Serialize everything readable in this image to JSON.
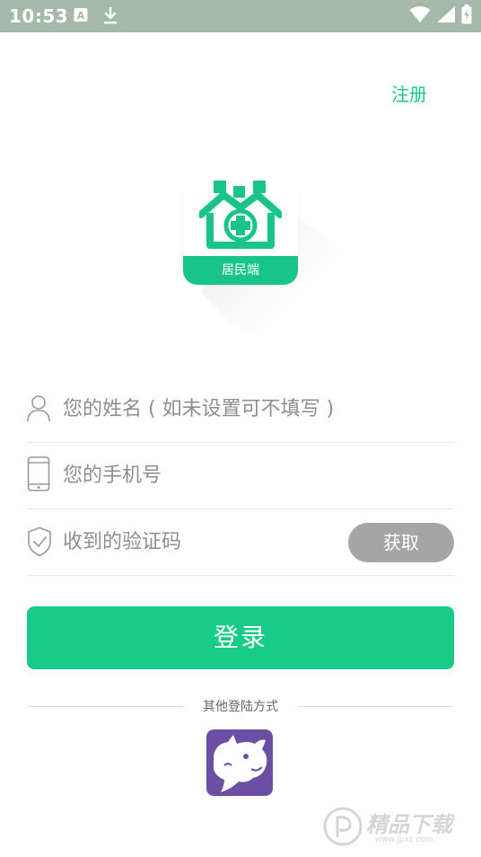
{
  "status_bar": {
    "time": "10:53",
    "icons": [
      "a-notification-icon",
      "download-icon",
      "wifi-icon",
      "signal-icon",
      "battery-icon"
    ]
  },
  "header": {
    "register_label": "注册"
  },
  "logo": {
    "caption": "居民端"
  },
  "form": {
    "name_placeholder": "您的姓名 ( 如未设置可不填写 )",
    "phone_placeholder": "您的手机号",
    "code_placeholder": "收到的验证码",
    "get_code_label": "获取"
  },
  "login": {
    "button_label": "登录"
  },
  "other_login": {
    "label": "其他登陆方式"
  },
  "watermark": {
    "text": "精品下载",
    "url_text": "www.jpxz.com"
  },
  "colors": {
    "accent": "#18cc88",
    "status_bar": "#a5b9ab",
    "disabled_button": "#a5a5a5",
    "third_party_bg": "#6b4fa3"
  }
}
